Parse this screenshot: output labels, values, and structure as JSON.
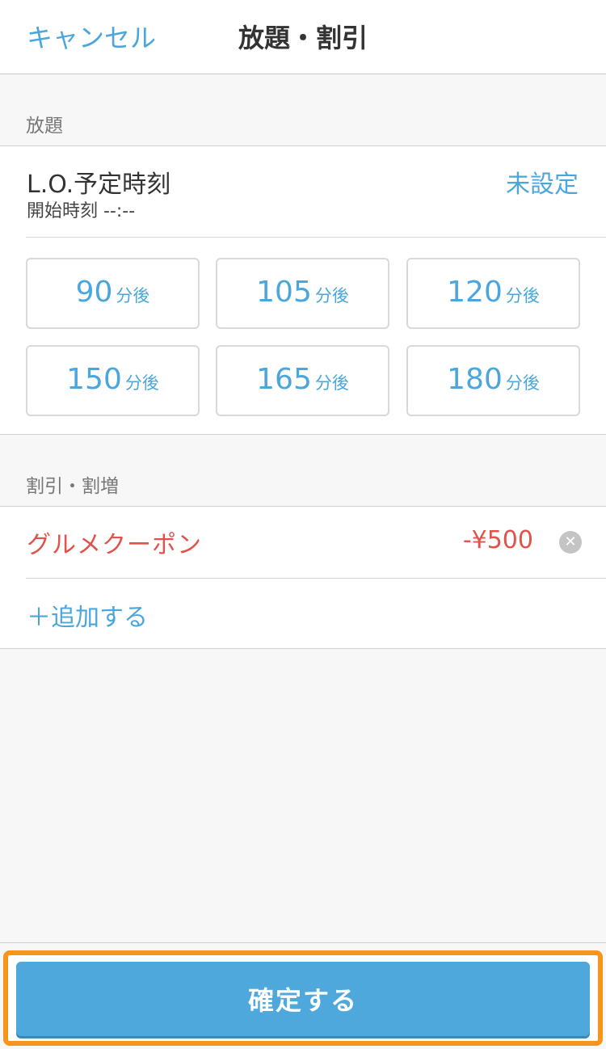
{
  "nav": {
    "cancel_label": "キャンセル",
    "title": "放題・割引"
  },
  "all_you_can": {
    "section_title": "放題",
    "lo_title": "L.O.予定時刻",
    "start_time": "開始時刻 --:--",
    "lo_value": "未設定",
    "time_options": [
      {
        "value": "90",
        "unit": "分後"
      },
      {
        "value": "105",
        "unit": "分後"
      },
      {
        "value": "120",
        "unit": "分後"
      },
      {
        "value": "150",
        "unit": "分後"
      },
      {
        "value": "165",
        "unit": "分後"
      },
      {
        "value": "180",
        "unit": "分後"
      }
    ]
  },
  "discounts": {
    "section_title": "割引・割増",
    "items": [
      {
        "label": "グルメクーポン",
        "amount": "-¥500"
      }
    ],
    "add_label": "＋追加する"
  },
  "footer": {
    "confirm_label": "確定する"
  },
  "colors": {
    "accent": "#4aa6dc",
    "discount": "#e0524a",
    "highlight": "#f7941d"
  }
}
